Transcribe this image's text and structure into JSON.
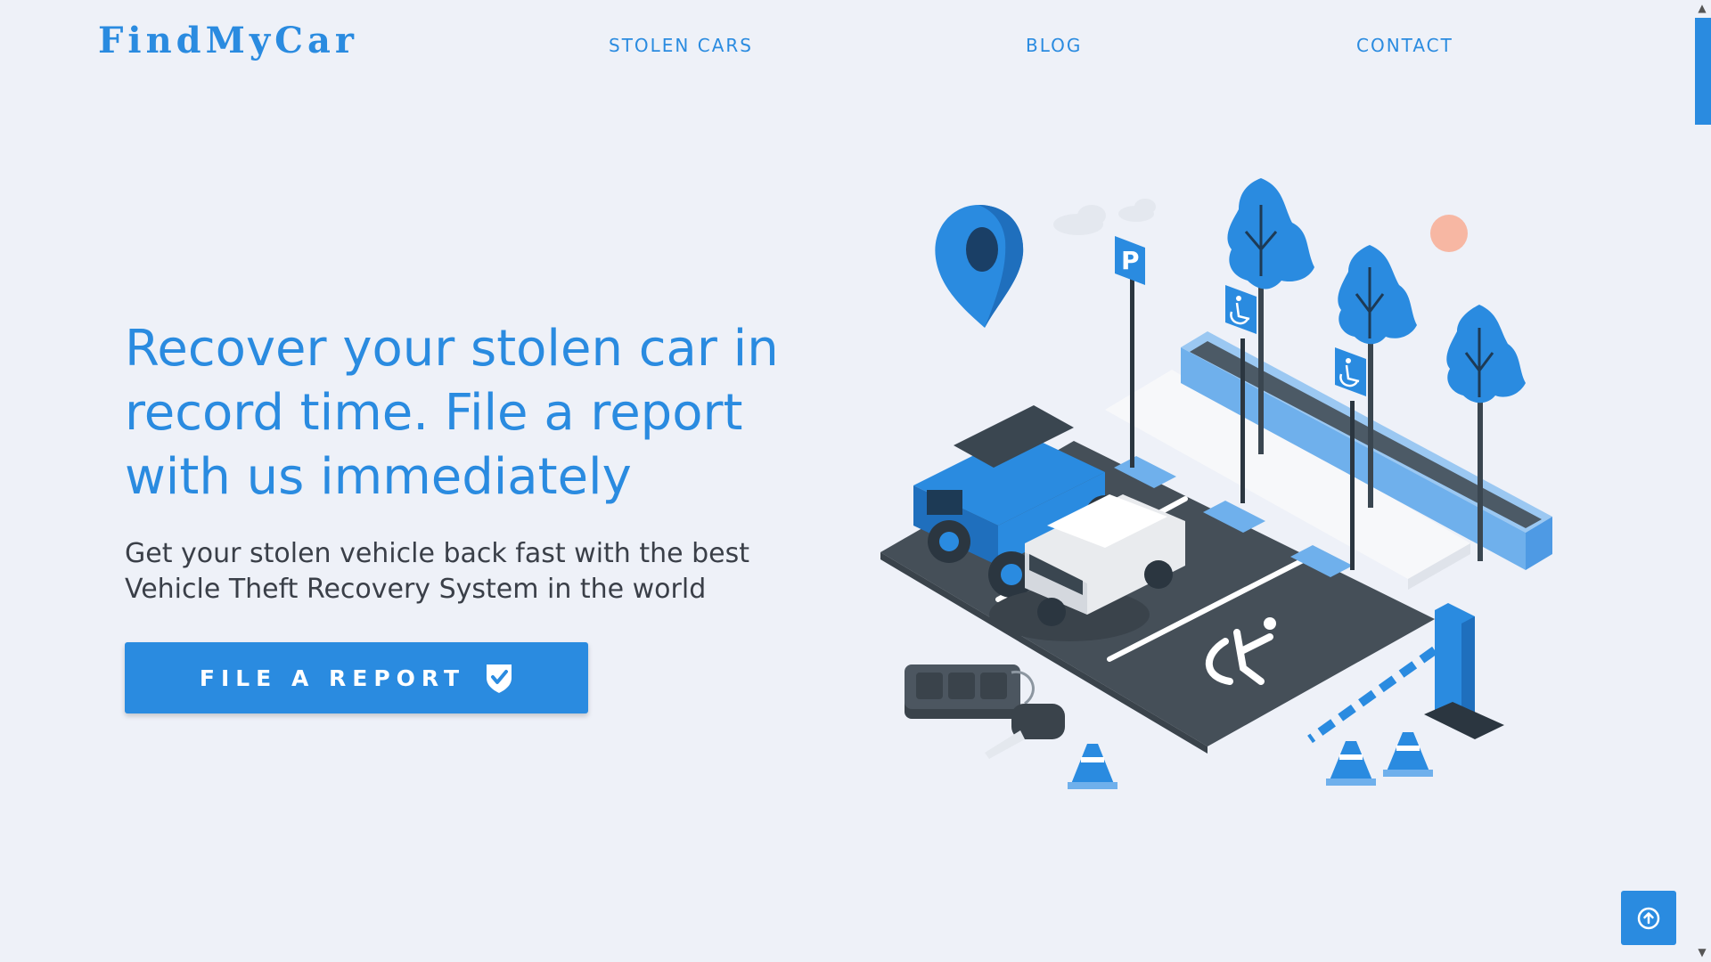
{
  "header": {
    "brand": "FindMyCar",
    "nav": [
      {
        "label": "STOLEN CARS"
      },
      {
        "label": "BLOG"
      },
      {
        "label": "CONTACT"
      }
    ]
  },
  "hero": {
    "title": "Recover your stolen car in record time. File a report with us immediately",
    "subtitle": "Get your stolen vehicle back fast with the best Vehicle Theft Recovery System in the world",
    "cta_label": "FILE A REPORT",
    "cta_icon": "shield-check-icon"
  },
  "illustration": {
    "sign_text": "P",
    "description_icon": "parking-lot-illustration"
  },
  "scrollbar": {
    "up_arrow": "▲",
    "down_arrow": "▼"
  },
  "back_to_top_icon": "arrow-up-circle-icon",
  "colors": {
    "primary": "#2a8be0",
    "background": "#eef1f8",
    "text_dark": "#3a3f48",
    "asphalt": "#454f58",
    "light_blue": "#8cc0f0",
    "sun": "#f7b7a3"
  }
}
